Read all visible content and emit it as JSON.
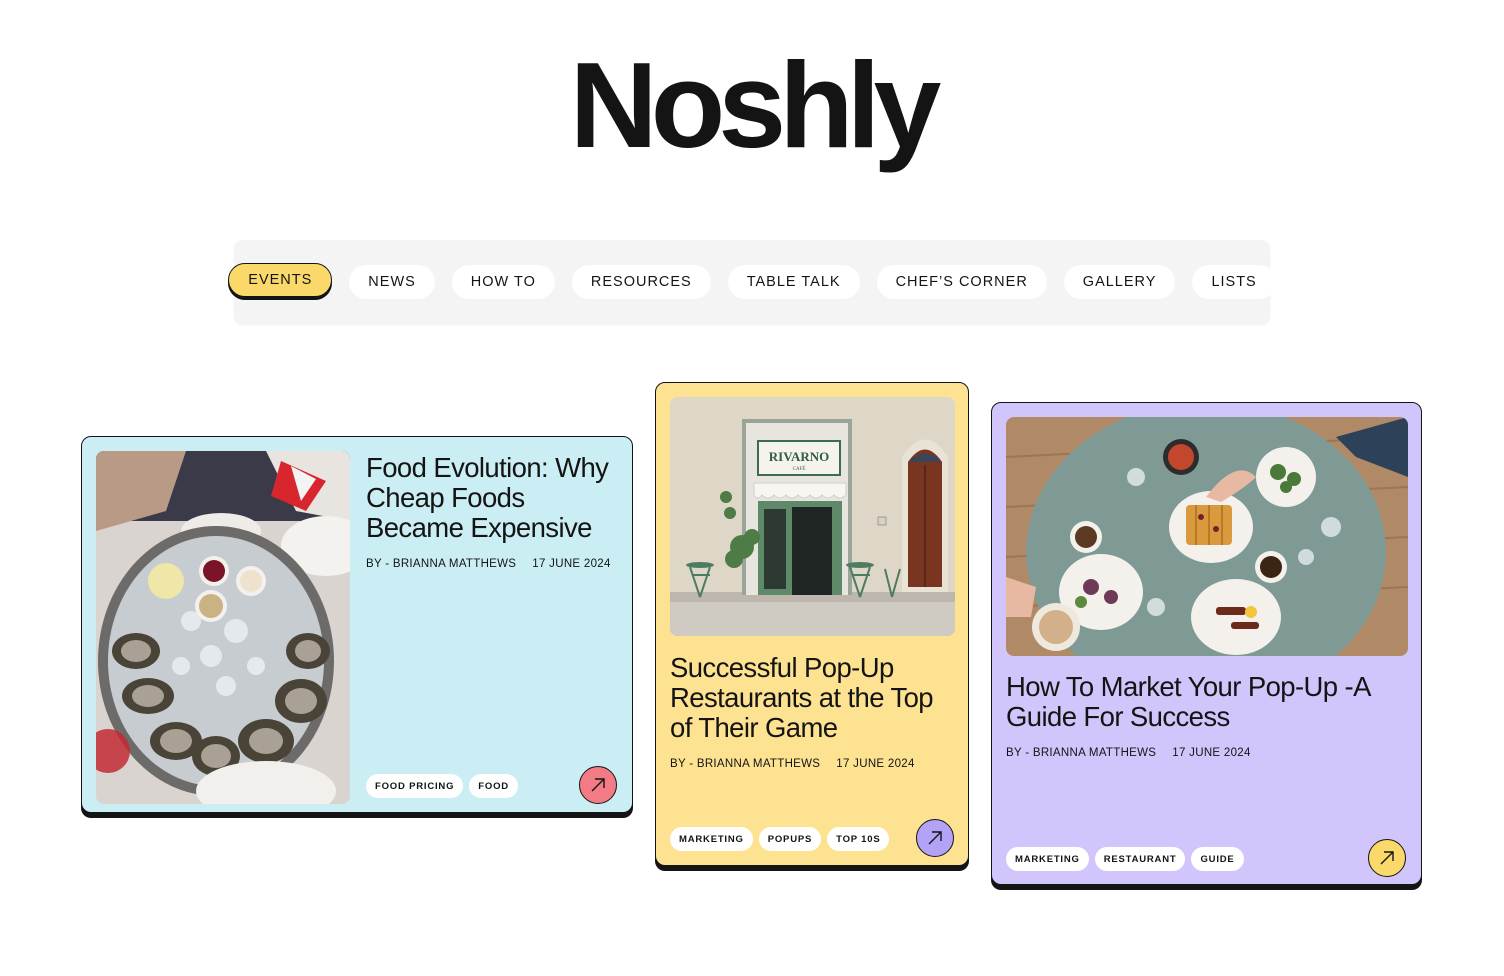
{
  "brand": {
    "name": "Noshly"
  },
  "nav": {
    "items": [
      {
        "label": "EVENTS",
        "active": true
      },
      {
        "label": "NEWS",
        "active": false
      },
      {
        "label": "HOW TO",
        "active": false
      },
      {
        "label": "RESOURCES",
        "active": false
      },
      {
        "label": "TABLE TALK",
        "active": false
      },
      {
        "label": "CHEF’S CORNER",
        "active": false
      },
      {
        "label": "GALLERY",
        "active": false
      },
      {
        "label": "LISTS",
        "active": false
      }
    ]
  },
  "cards": [
    {
      "title": "Food Evolution: Why Cheap Foods Became Expensive",
      "author": "BY - BRIANNA MATTHEWS",
      "date": "17 JUNE 2024",
      "tags": [
        "FOOD PRICING",
        "FOOD"
      ],
      "image": "oysters-platter",
      "background": "#cbeef4",
      "arrow_color": "#f27b86"
    },
    {
      "title": "Successful Pop-Up Restaurants at the Top of Their Game",
      "author": "BY - BRIANNA MATTHEWS",
      "date": "17 JUNE 2024",
      "tags": [
        "MARKETING",
        "POPUPS",
        "TOP 10S"
      ],
      "image": "cafe-storefront",
      "storefront_sign": "RIVARNO",
      "background": "#fde291",
      "arrow_color": "#b4a2f6"
    },
    {
      "title": "How To Market Your Pop-Up -A Guide For Success",
      "author": "BY - BRIANNA MATTHEWS",
      "date": "17 JUNE 2024",
      "tags": [
        "MARKETING",
        "RESTAURANT",
        "GUIDE"
      ],
      "image": "brunch-table",
      "background": "#d1c5fb",
      "arrow_color": "#fad96a"
    }
  ]
}
